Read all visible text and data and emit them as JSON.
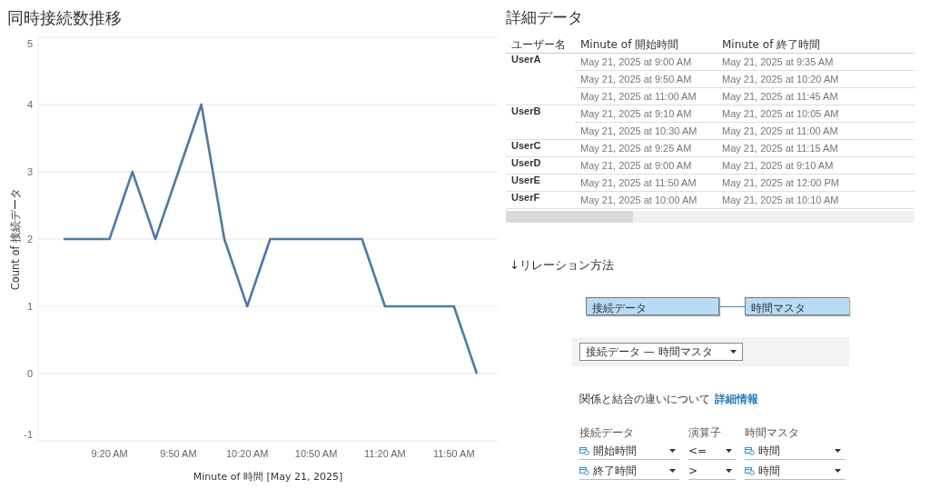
{
  "chart": {
    "title": "同時接続数推移",
    "chart_data": {
      "type": "line",
      "xlabel": "Minute of 時間 [May 21, 2025]",
      "ylabel": "Count of 接続データ",
      "categories": [
        null,
        null,
        "9:20 AM",
        null,
        null,
        "9:50 AM",
        null,
        null,
        "10:20 AM",
        null,
        null,
        "10:50 AM",
        null,
        null,
        "11:20 AM",
        null,
        null,
        "11:50 AM",
        null
      ],
      "series": [
        {
          "color": "#4e79a7",
          "values": [
            2,
            2,
            2,
            3,
            2,
            3,
            4,
            2,
            1,
            2,
            2,
            2,
            2,
            2,
            1,
            1,
            1,
            1,
            0
          ]
        }
      ],
      "ylim": [
        -1,
        5
      ],
      "grid": true,
      "yticks": [
        {
          "value": 5,
          "label": "5"
        },
        {
          "value": 4,
          "label": "4"
        },
        {
          "value": 3,
          "label": "3"
        },
        {
          "value": 2,
          "label": "2"
        },
        {
          "value": 1,
          "label": "1"
        },
        {
          "value": 0,
          "label": "0"
        },
        {
          "value": -1,
          "label": "-1"
        }
      ]
    }
  },
  "detail": {
    "title": "詳細データ",
    "columns": [
      "ユーザー名",
      "Minute of 開始時間",
      "Minute of 終了時間"
    ],
    "groups": [
      {
        "user": "UserA",
        "rows": [
          [
            "May 21, 2025 at 9:00 AM",
            "May 21, 2025 at 9:35 AM"
          ],
          [
            "May 21, 2025 at 9:50 AM",
            "May 21, 2025 at 10:20 AM"
          ],
          [
            "May 21, 2025 at 11:00 AM",
            "May 21, 2025 at 11:45 AM"
          ]
        ]
      },
      {
        "user": "UserB",
        "rows": [
          [
            "May 21, 2025 at 9:10 AM",
            "May 21, 2025 at 10:05 AM"
          ],
          [
            "May 21, 2025 at 10:30 AM",
            "May 21, 2025 at 11:00 AM"
          ]
        ]
      },
      {
        "user": "UserC",
        "rows": [
          [
            "May 21, 2025 at 9:25 AM",
            "May 21, 2025 at 11:15 AM"
          ]
        ]
      },
      {
        "user": "UserD",
        "rows": [
          [
            "May 21, 2025 at 9:00 AM",
            "May 21, 2025 at 9:10 AM"
          ]
        ]
      },
      {
        "user": "UserE",
        "rows": [
          [
            "May 21, 2025 at 11:50 AM",
            "May 21, 2025 at 12:00 PM"
          ]
        ]
      },
      {
        "user": "UserF",
        "rows": [
          [
            "May 21, 2025 at 10:00 AM",
            "May 21, 2025 at 10:10 AM"
          ]
        ]
      }
    ]
  },
  "relation": {
    "title": "↓リレーション方法",
    "tables": [
      "接続データ",
      "時間マスタ"
    ],
    "selector": "接続データ — 時間マスタ",
    "info_text": "関係と結合の違いについて",
    "info_link": "詳細情報",
    "columns": [
      "接続データ",
      "演算子",
      "時間マスタ"
    ],
    "conditions": [
      {
        "left": "開始時間",
        "operator": "<=",
        "right": "時間"
      },
      {
        "left": "終了時間",
        "operator": ">",
        "right": "時間"
      }
    ]
  }
}
